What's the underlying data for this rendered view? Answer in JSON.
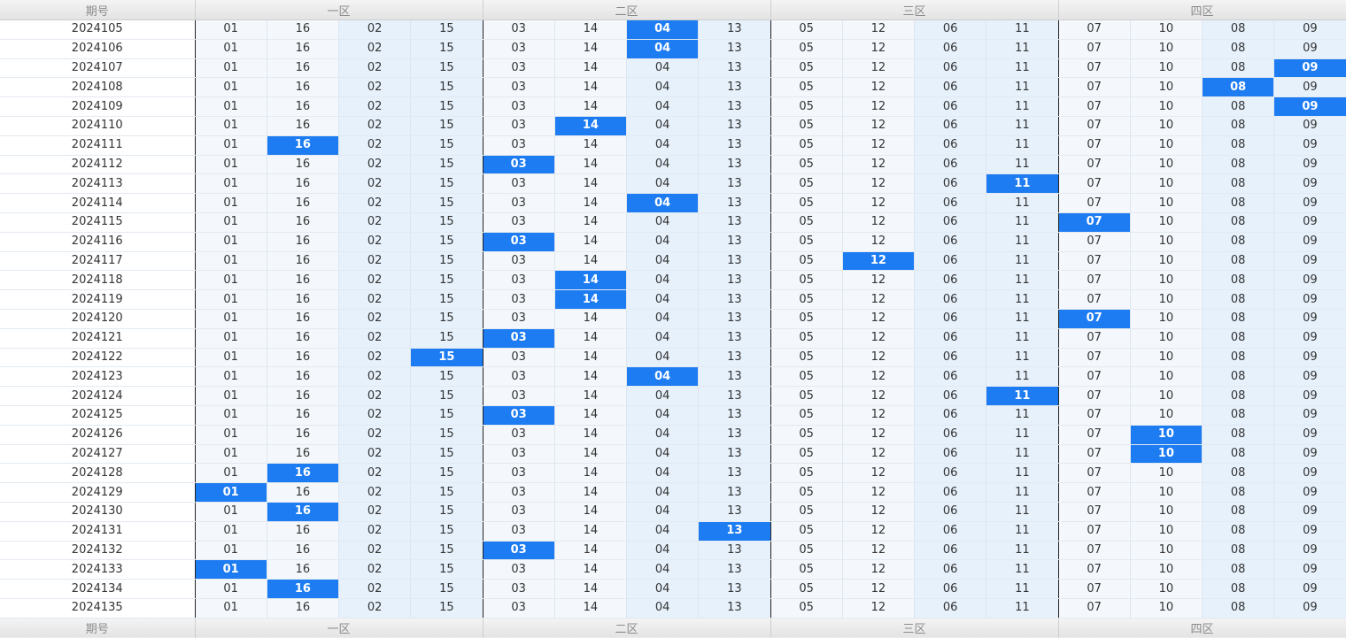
{
  "header": {
    "period_label": "期号",
    "zones": [
      "一区",
      "二区",
      "三区",
      "四区"
    ]
  },
  "footer": {
    "period_label": "期号",
    "zones": [
      "一区",
      "二区",
      "三区",
      "四区"
    ]
  },
  "columns": [
    [
      "01",
      "16",
      "02",
      "15"
    ],
    [
      "03",
      "14",
      "04",
      "13"
    ],
    [
      "05",
      "12",
      "06",
      "11"
    ],
    [
      "07",
      "10",
      "08",
      "09"
    ]
  ],
  "rows": [
    {
      "period": "2024105",
      "hits": [
        6
      ]
    },
    {
      "period": "2024106",
      "hits": [
        6
      ]
    },
    {
      "period": "2024107",
      "hits": [
        15
      ]
    },
    {
      "period": "2024108",
      "hits": [
        14
      ]
    },
    {
      "period": "2024109",
      "hits": [
        15
      ]
    },
    {
      "period": "2024110",
      "hits": [
        5
      ]
    },
    {
      "period": "2024111",
      "hits": [
        1
      ]
    },
    {
      "period": "2024112",
      "hits": [
        4
      ]
    },
    {
      "period": "2024113",
      "hits": [
        11
      ]
    },
    {
      "period": "2024114",
      "hits": [
        6
      ]
    },
    {
      "period": "2024115",
      "hits": [
        12
      ]
    },
    {
      "period": "2024116",
      "hits": [
        4
      ]
    },
    {
      "period": "2024117",
      "hits": [
        9
      ]
    },
    {
      "period": "2024118",
      "hits": [
        5
      ]
    },
    {
      "period": "2024119",
      "hits": [
        5
      ]
    },
    {
      "period": "2024120",
      "hits": [
        12
      ]
    },
    {
      "period": "2024121",
      "hits": [
        4
      ]
    },
    {
      "period": "2024122",
      "hits": [
        3
      ]
    },
    {
      "period": "2024123",
      "hits": [
        6
      ]
    },
    {
      "period": "2024124",
      "hits": [
        11
      ]
    },
    {
      "period": "2024125",
      "hits": [
        4
      ]
    },
    {
      "period": "2024126",
      "hits": [
        13
      ]
    },
    {
      "period": "2024127",
      "hits": [
        13
      ]
    },
    {
      "period": "2024128",
      "hits": [
        1
      ]
    },
    {
      "period": "2024129",
      "hits": [
        0
      ]
    },
    {
      "period": "2024130",
      "hits": [
        1
      ]
    },
    {
      "period": "2024131",
      "hits": [
        7
      ]
    },
    {
      "period": "2024132",
      "hits": [
        4
      ]
    },
    {
      "period": "2024133",
      "hits": [
        0
      ]
    },
    {
      "period": "2024134",
      "hits": [
        1
      ]
    },
    {
      "period": "2024135",
      "hits": []
    }
  ],
  "colors": {
    "hit": "#1e7cf2",
    "header_bg": "#e8e8e8",
    "cell_light": "#f4f8fc",
    "cell_blue": "#e6f1fc"
  }
}
